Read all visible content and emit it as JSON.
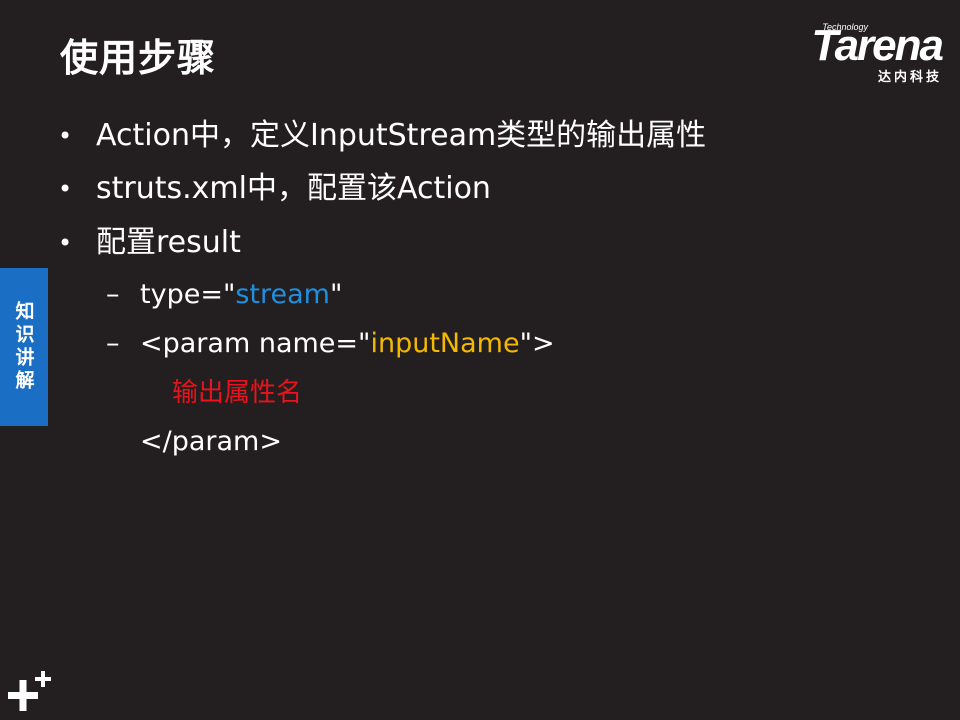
{
  "header": {
    "title": "使用步骤"
  },
  "logo": {
    "tech": "Technology",
    "word": "Tarena",
    "cn": "达内科技"
  },
  "side_tab": {
    "label": "知识讲解",
    "color": "#1a6fc4"
  },
  "bullets": [
    {
      "marker": "•",
      "text": "Action中，定义InputStream类型的输出属性"
    },
    {
      "marker": "•",
      "text": "struts.xml中，配置该Action"
    },
    {
      "marker": "•",
      "text": "配置result"
    }
  ],
  "sub_items": [
    {
      "marker": "–",
      "prefix": "type=\"",
      "highlight": "stream",
      "suffix": "\"",
      "highlight_color": "#1f8fe0"
    },
    {
      "marker": "–",
      "prefix": "<param name=\"",
      "highlight": "inputName",
      "suffix": "\">",
      "highlight_color": "#f5b800"
    }
  ],
  "note": {
    "text": "输出属性名",
    "color": "#e8131b"
  },
  "closing_tag": "</param>",
  "colors": {
    "background": "#231f20",
    "text": "#ffffff"
  },
  "icons": {
    "bottom_left": "plus-plus-icon"
  }
}
